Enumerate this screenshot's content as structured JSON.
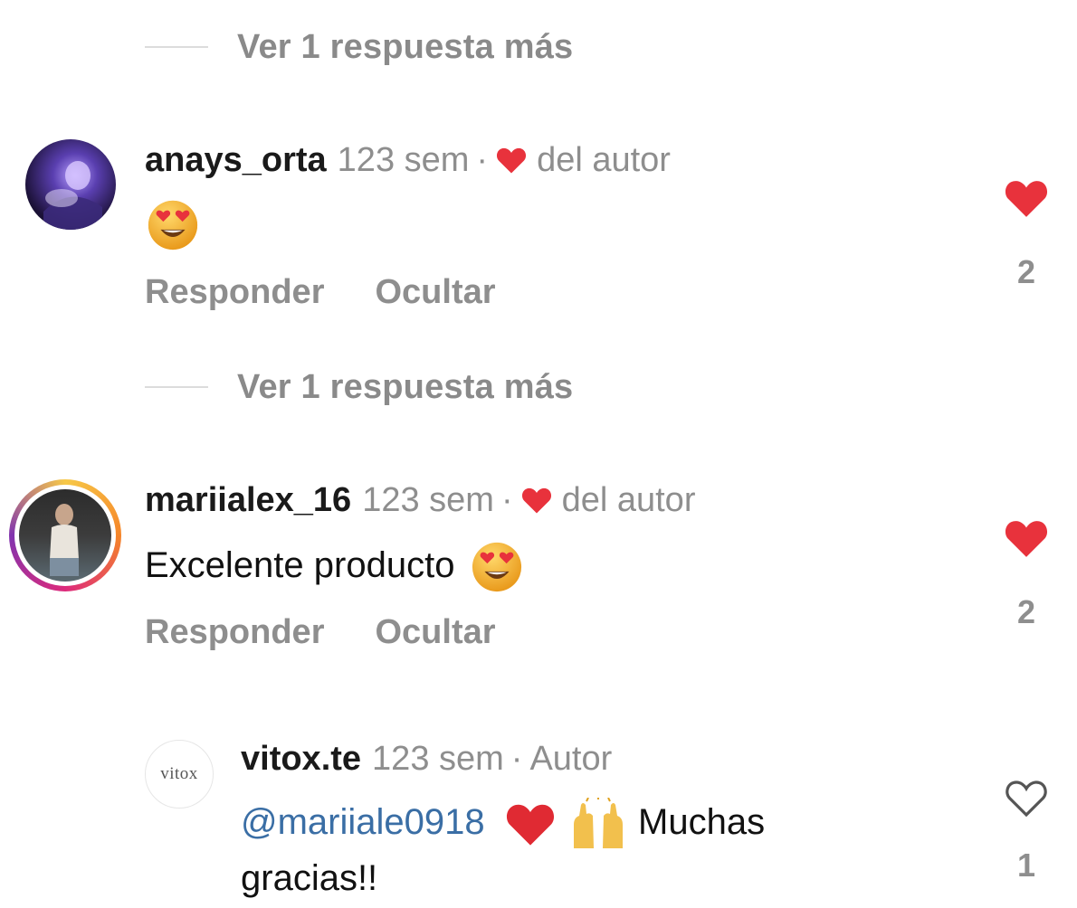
{
  "more_replies_label": "Ver 1 respuesta más",
  "comments": [
    {
      "username": "anays_orta",
      "time": "123 sem",
      "separator": "·",
      "liked_by_author": "del autor",
      "text": "",
      "actions": [
        "Responder",
        "Ocultar"
      ],
      "likes": "2",
      "liked": true
    },
    {
      "username": "mariialex_16",
      "time": "123 sem",
      "separator": "·",
      "liked_by_author": "del autor",
      "text": "Excelente producto",
      "actions": [
        "Responder",
        "Ocultar"
      ],
      "likes": "2",
      "liked": true
    }
  ],
  "reply": {
    "username": "vitox.te",
    "time": "123 sem",
    "separator": "·",
    "badge": "Autor",
    "mention": "@mariiale0918",
    "text_line1": "Muchas",
    "text_line2": "gracias!!",
    "likes": "1",
    "liked": false,
    "avatar_text": "vitox"
  },
  "colors": {
    "like_red": "#e8323c",
    "meta_gray": "#8e8e8e",
    "mention_blue": "#3a6ea5"
  }
}
